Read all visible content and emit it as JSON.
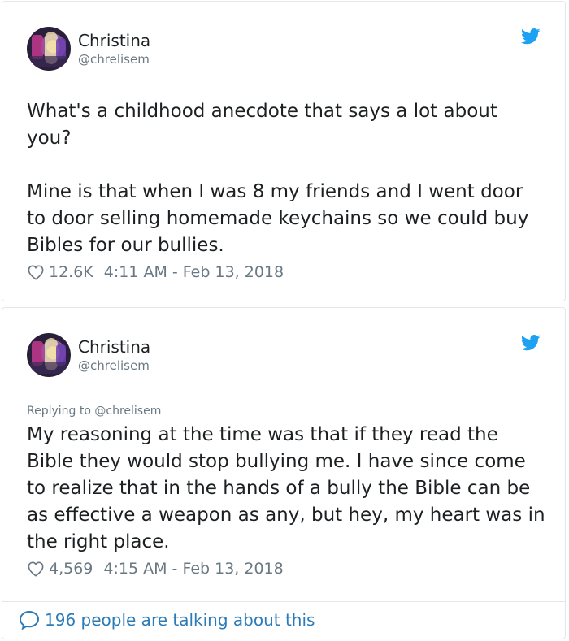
{
  "tweets": [
    {
      "author": {
        "name": "Christina",
        "handle": "@chrelisem"
      },
      "reply_to": "",
      "text": "What's a childhood anecdote that says a lot about you?\n\nMine is that when I was 8 my friends and I went door to door selling homemade keychains so we could buy Bibles for our bullies.",
      "likes": "12.6K",
      "timestamp": "4:11 AM - Feb 13, 2018"
    },
    {
      "author": {
        "name": "Christina",
        "handle": "@chrelisem"
      },
      "reply_to": "Replying to @chrelisem",
      "text": "My reasoning at the time was that if they read the Bible they would stop bullying me. I have since come to realize that in the hands of a bully the Bible can be as effective a weapon as any, but hey, my heart was in the right place.",
      "likes": "4,569",
      "timestamp": "4:15 AM - Feb 13, 2018"
    }
  ],
  "conversation": {
    "talking_label": "196 people are talking about this"
  },
  "icons": {
    "brand": "twitter-bird-icon",
    "like": "heart-outline-icon",
    "comment": "speech-bubble-icon"
  },
  "colors": {
    "twitter_blue": "#1da1f2",
    "link_blue": "#2b7bb9",
    "meta_gray": "#697882",
    "text": "#1c2022",
    "border": "#e1e8ed"
  }
}
